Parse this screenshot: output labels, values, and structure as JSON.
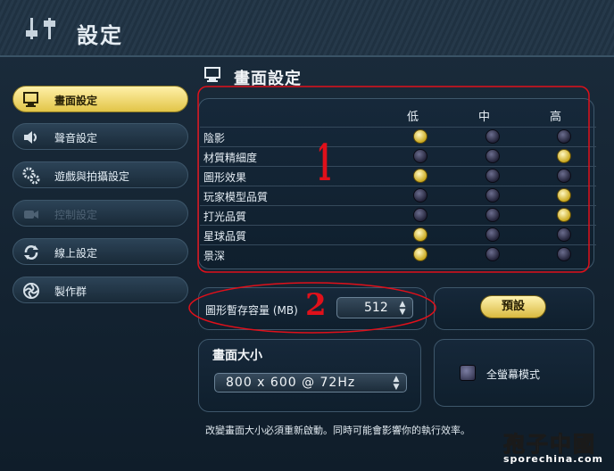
{
  "window": {
    "title": "設定",
    "title_icon": "sliders-icon"
  },
  "sidebar": {
    "items": [
      {
        "label": "畫面設定",
        "icon": "monitor-icon",
        "active": true,
        "disabled": false
      },
      {
        "label": "聲音設定",
        "icon": "speaker-icon",
        "active": false,
        "disabled": false
      },
      {
        "label": "遊戲與拍攝設定",
        "icon": "gears-icon",
        "active": false,
        "disabled": false
      },
      {
        "label": "控制設定",
        "icon": "camera-icon",
        "active": false,
        "disabled": true
      },
      {
        "label": "線上設定",
        "icon": "refresh-icon",
        "active": false,
        "disabled": false
      },
      {
        "label": "製作群",
        "icon": "swirl-icon",
        "active": false,
        "disabled": false
      }
    ]
  },
  "main": {
    "title": "畫面設定",
    "quality": {
      "columns": [
        "低",
        "中",
        "高"
      ],
      "rows": [
        {
          "name": "陰影",
          "selected": 0
        },
        {
          "name": "材質精細度",
          "selected": 2
        },
        {
          "name": "圖形效果",
          "selected": 0
        },
        {
          "name": "玩家模型品質",
          "selected": 2
        },
        {
          "name": "打光品質",
          "selected": 2
        },
        {
          "name": "星球品質",
          "selected": 0
        },
        {
          "name": "景深",
          "selected": 0
        }
      ]
    },
    "texture_memory": {
      "label": "圖形暫存容量 (MB)",
      "value": "512"
    },
    "default_button": "預設",
    "screen_size": {
      "title": "畫面大小",
      "value": "800 x 600 @ 72Hz"
    },
    "fullscreen": {
      "label": "全螢幕模式",
      "checked": false
    },
    "note": "改變畫面大小必須重新啟動。同時可能會影響你的執行效率。"
  },
  "annotations": {
    "mark1": "1",
    "mark2": "2"
  },
  "watermark": {
    "text": "孢子中國",
    "url_text": "sporechina.com"
  },
  "colors": {
    "accent": "#e2c548",
    "selected_dot": "#c9a81f",
    "annotation": "#e0101a"
  }
}
